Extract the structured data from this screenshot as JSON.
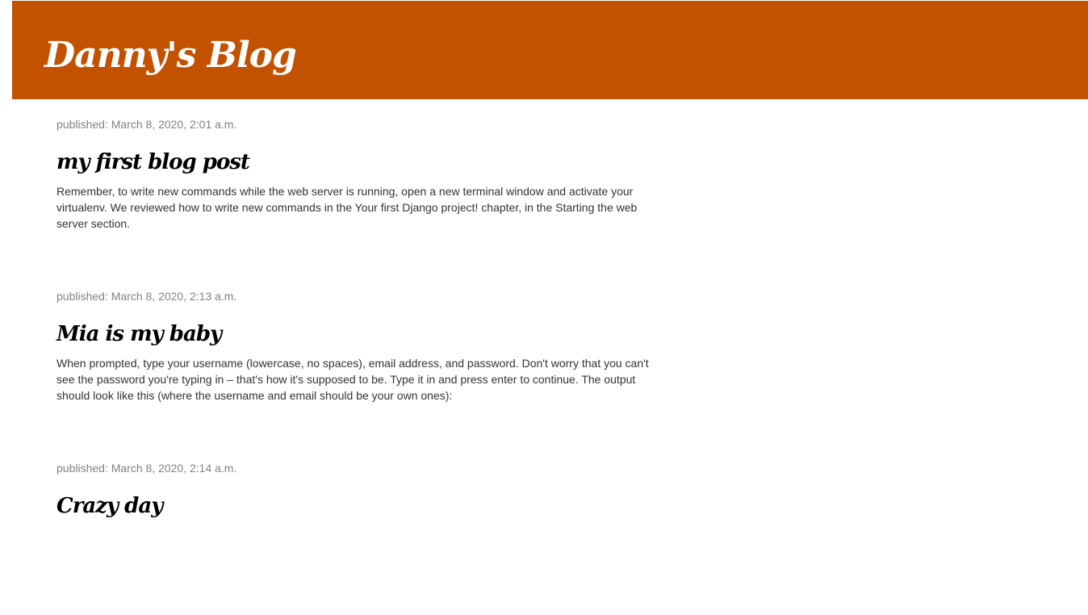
{
  "header": {
    "site_title": "Danny's Blog"
  },
  "posts": [
    {
      "date": "published: March 8, 2020, 2:01 a.m.",
      "title": "my first blog post",
      "text": "Remember, to write new commands while the web server is running, open a new terminal window and activate your virtualenv. We reviewed how to write new commands in the Your first Django project! chapter, in the Starting the web server section."
    },
    {
      "date": "published: March 8, 2020, 2:13 a.m.",
      "title": "Mia is my baby",
      "text": "When prompted, type your username (lowercase, no spaces), email address, and password. Don't worry that you can't see the password you're typing in – that's how it's supposed to be. Type it in and press enter to continue. The output should look like this (where the username and email should be your own ones):"
    },
    {
      "date": "published: March 8, 2020, 2:14 a.m.",
      "title": "Crazy day",
      "text": ""
    }
  ],
  "colors": {
    "header_background": "#C25100",
    "title_text": "#ffffff",
    "date_text": "#828282",
    "body_text": "#333333"
  }
}
